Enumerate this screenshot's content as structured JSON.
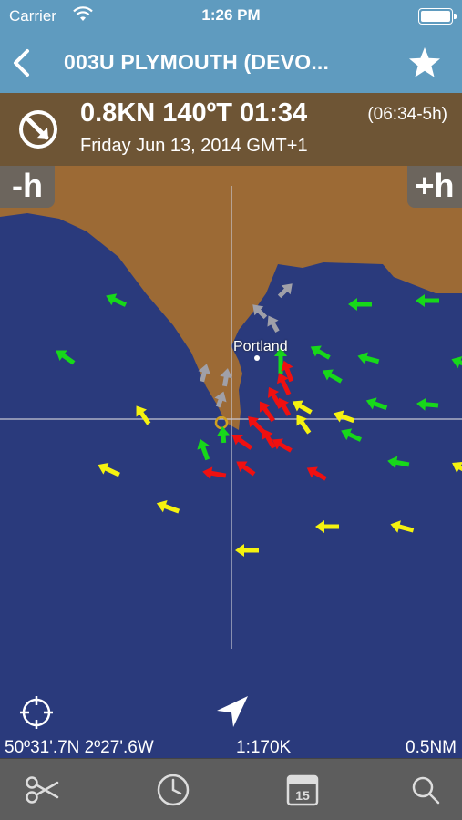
{
  "status_bar": {
    "carrier": "Carrier",
    "time": "1:26 PM"
  },
  "nav": {
    "title": "003U PLYMOUTH (DEVO..."
  },
  "info": {
    "headline": "0.8KN 140ºT 01:34",
    "range": "(06:34-5h)",
    "date": "Friday Jun 13, 2014 GMT+1"
  },
  "map": {
    "minus_label": "-h",
    "plus_label": "+h",
    "place_label": "Portland",
    "colors": {
      "sea": "#2a3a7c",
      "land": "#9c6a35",
      "green": "#17d81a",
      "yellow": "#f5f20f",
      "red": "#ef1010",
      "gray": "#a0a0a8"
    }
  },
  "bottom": {
    "coords": "50º31'.7N 2º27'.6W",
    "scale": "1:170K",
    "distance": "0.5NM"
  },
  "tabs": [
    {
      "icon": "scissors-icon"
    },
    {
      "icon": "clock-icon"
    },
    {
      "icon": "calendar-icon",
      "label": "15"
    },
    {
      "icon": "search-icon"
    }
  ]
}
